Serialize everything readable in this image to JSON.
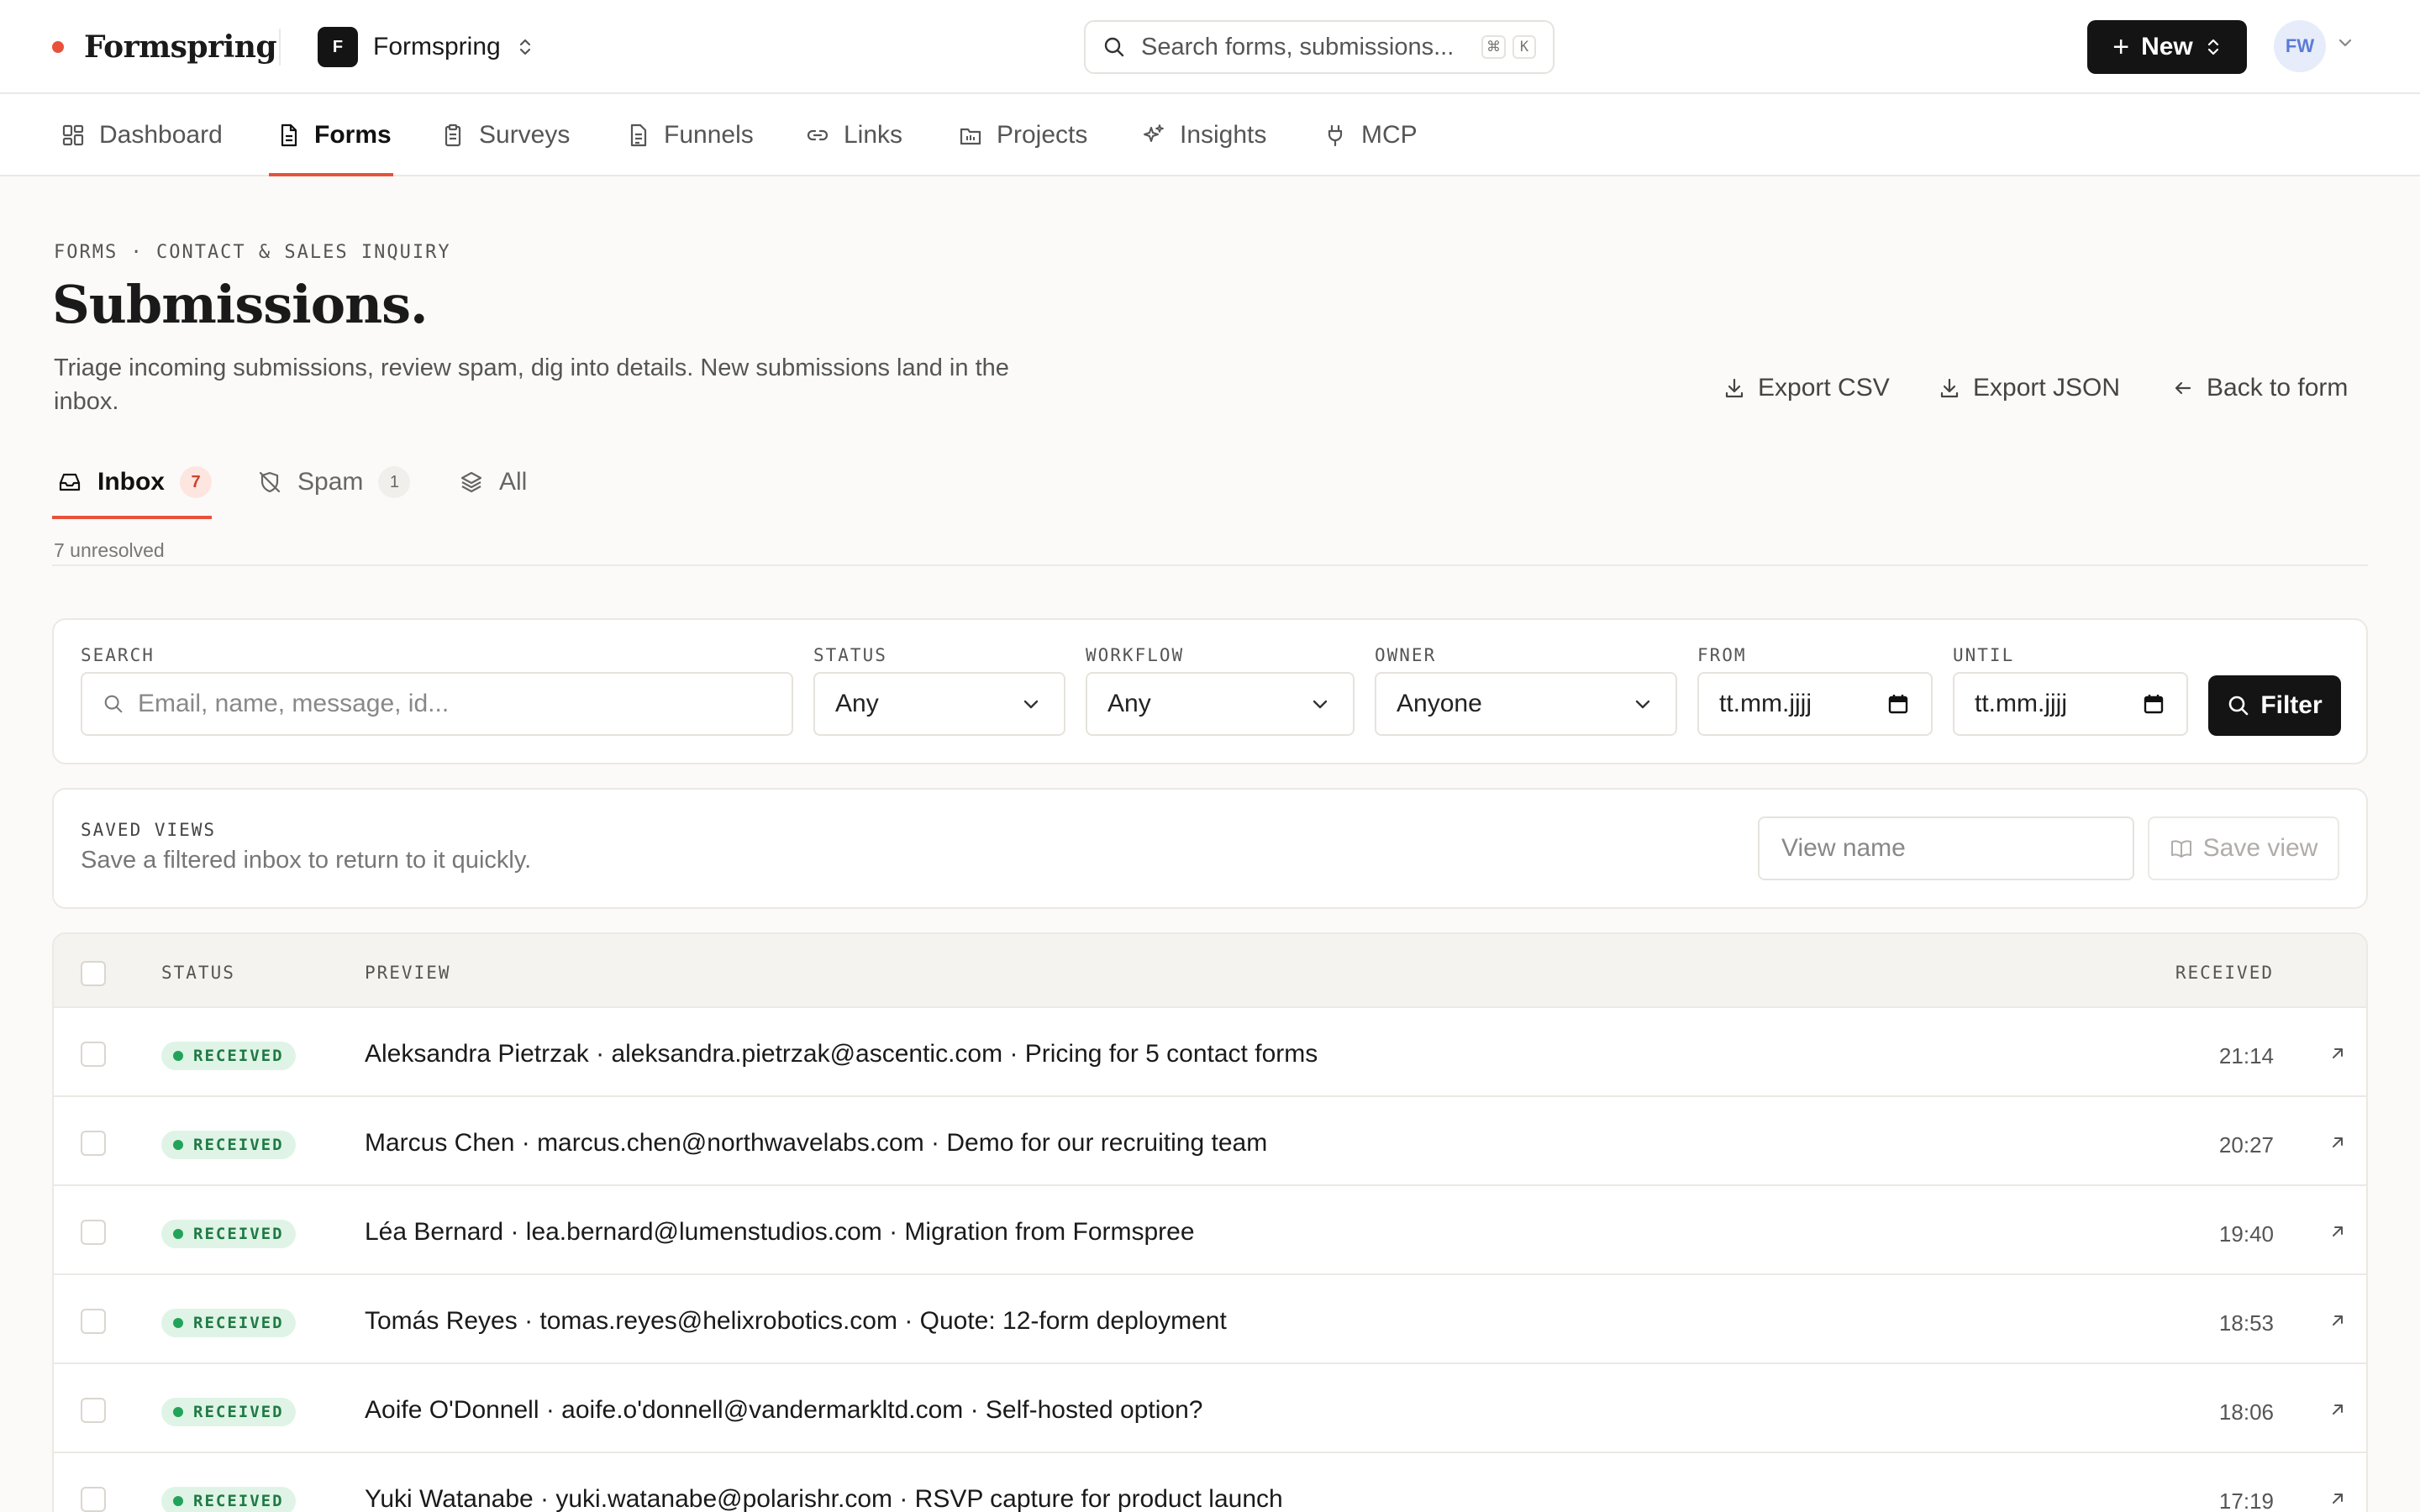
{
  "app": {
    "brand_name": "Formspring",
    "workspace_initial": "F",
    "workspace_name": "Formspring",
    "search_placeholder": "Search forms, submissions...",
    "shortcut_keys": [
      "⌘",
      "K"
    ],
    "new_label": "New",
    "avatar_initials": "FW",
    "accent_color": "#e8523a"
  },
  "nav": {
    "items": [
      {
        "label": "Dashboard",
        "icon": "grid-icon"
      },
      {
        "label": "Forms",
        "icon": "document-icon",
        "active": true
      },
      {
        "label": "Surveys",
        "icon": "clipboard-icon"
      },
      {
        "label": "Funnels",
        "icon": "document-lines-icon"
      },
      {
        "label": "Links",
        "icon": "link-icon"
      },
      {
        "label": "Projects",
        "icon": "folder-icon"
      },
      {
        "label": "Insights",
        "icon": "sparkles-icon"
      },
      {
        "label": "MCP",
        "icon": "plug-icon"
      }
    ]
  },
  "header": {
    "breadcrumb": "FORMS · CONTACT & SALES INQUIRY",
    "title": "Submissions.",
    "subtitle": "Triage incoming submissions, review spam, dig into details. New submissions land in the inbox.",
    "actions": {
      "export_csv": "Export CSV",
      "export_json": "Export JSON",
      "back": "Back to form"
    }
  },
  "tabs": {
    "inbox": {
      "label": "Inbox",
      "count": "7"
    },
    "spam": {
      "label": "Spam",
      "count": "1"
    },
    "all": {
      "label": "All"
    },
    "unresolved_text": "7 unresolved"
  },
  "filters": {
    "search_label": "SEARCH",
    "search_placeholder": "Email, name, message, id...",
    "status_label": "STATUS",
    "status_value": "Any",
    "workflow_label": "WORKFLOW",
    "workflow_value": "Any",
    "owner_label": "OWNER",
    "owner_value": "Anyone",
    "from_label": "FROM",
    "from_value": "tt.mm.jjjj",
    "until_label": "UNTIL",
    "until_value": "tt.mm.jjjj",
    "filter_button": "Filter"
  },
  "saved_views": {
    "label": "SAVED VIEWS",
    "description": "Save a filtered inbox to return to it quickly.",
    "name_placeholder": "View name",
    "save_button": "Save view"
  },
  "table": {
    "headers": {
      "status": "STATUS",
      "preview": "PREVIEW",
      "received": "RECEIVED"
    },
    "rows": [
      {
        "status": "RECEIVED",
        "preview": "Aleksandra Pietrzak · aleksandra.pietrzak@ascentic.com · Pricing for 5 contact forms",
        "time": "21:14"
      },
      {
        "status": "RECEIVED",
        "preview": "Marcus Chen · marcus.chen@northwavelabs.com · Demo for our recruiting team",
        "time": "20:27"
      },
      {
        "status": "RECEIVED",
        "preview": "Léa Bernard · lea.bernard@lumenstudios.com · Migration from Formspree",
        "time": "19:40"
      },
      {
        "status": "RECEIVED",
        "preview": "Tomás Reyes · tomas.reyes@helixrobotics.com · Quote: 12-form deployment",
        "time": "18:53"
      },
      {
        "status": "RECEIVED",
        "preview": "Aoife O'Donnell · aoife.o'donnell@vandermarkltd.com · Self-hosted option?",
        "time": "18:06"
      },
      {
        "status": "RECEIVED",
        "preview": "Yuki Watanabe · yuki.watanabe@polarishr.com · RSVP capture for product launch",
        "time": "17:19"
      }
    ]
  }
}
